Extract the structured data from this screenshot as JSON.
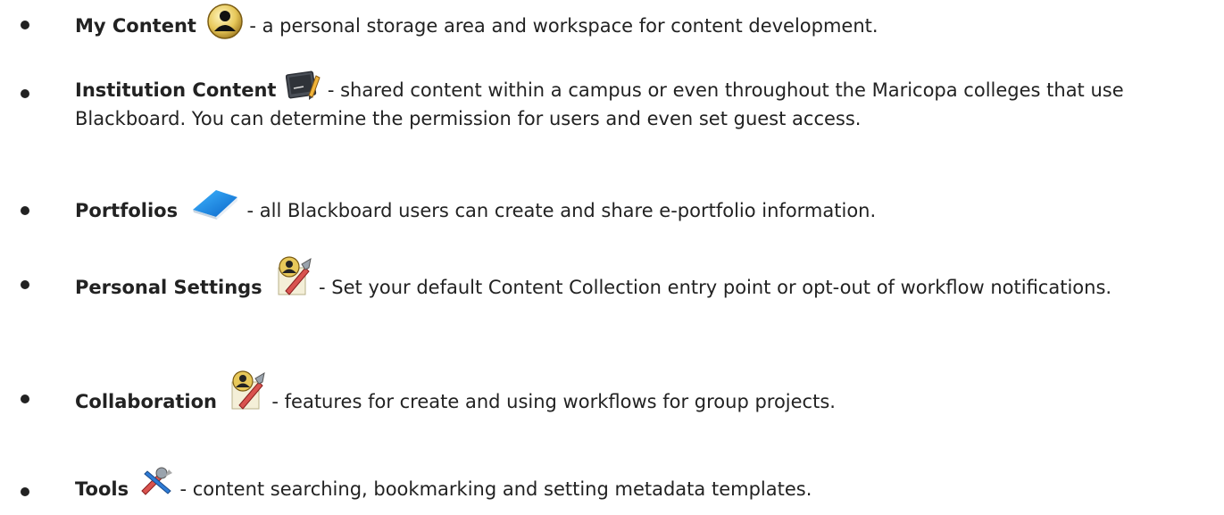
{
  "items": [
    {
      "term": "My Content",
      "icon": "user-circle-icon",
      "description": " - a personal storage area and workspace for content development."
    },
    {
      "term": "Institution Content",
      "icon": "chalkboard-pencil-icon",
      "description": " - shared content within a campus or even throughout the Maricopa colleges that use Blackboard. You can determine the permission for users and even set guest access."
    },
    {
      "term": "Portfolios",
      "icon": "blue-book-icon",
      "description": " - all Blackboard users can create and share e-portfolio information."
    },
    {
      "term": "Personal Settings",
      "icon": "user-settings-icon",
      "description": " - Set your default Content Collection entry point or opt-out of workflow notifications."
    },
    {
      "term": "Collaboration",
      "icon": "user-settings-icon",
      "description": " - features for create and using workflows for group projects."
    },
    {
      "term": "Tools",
      "icon": "tools-icon",
      "description": " - content searching, bookmarking and setting metadata templates."
    }
  ]
}
